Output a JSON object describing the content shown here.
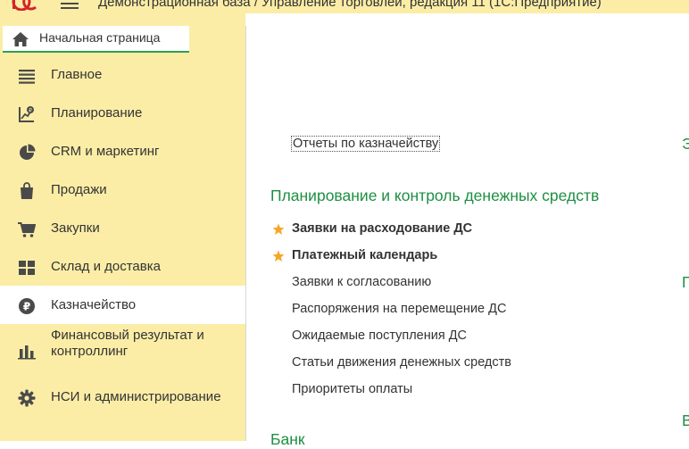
{
  "app": {
    "title": "Демонстрационная база / Управление торговлей, редакция 11  (1С:Предприятие)"
  },
  "home_tab": {
    "label": "Начальная страница",
    "icon": "home-icon"
  },
  "sidebar": {
    "items": [
      {
        "label": "Главное",
        "icon": "list-icon"
      },
      {
        "label": "Планирование",
        "icon": "planning-icon"
      },
      {
        "label": "CRM и маркетинг",
        "icon": "pie-chart-icon"
      },
      {
        "label": "Продажи",
        "icon": "shopping-bag-icon"
      },
      {
        "label": "Закупки",
        "icon": "cart-icon"
      },
      {
        "label": "Склад и доставка",
        "icon": "warehouse-grid-icon"
      },
      {
        "label": "Казначейство",
        "icon": "ruble-icon",
        "active": true
      },
      {
        "label": "Финансовый результат и\nконтроллинг",
        "icon": "bar-chart-icon"
      },
      {
        "label": "НСИ и администрирование",
        "icon": "gear-icon"
      }
    ]
  },
  "content": {
    "reports_link": "Отчеты по казначейству",
    "group_title": "Планирование и контроль денежных средств",
    "links": [
      {
        "label": "Заявки на расходование ДС",
        "favorite": true
      },
      {
        "label": "Платежный календарь",
        "favorite": true
      },
      {
        "label": "Заявки к согласованию",
        "favorite": false
      },
      {
        "label": "Распоряжения на перемещение ДС",
        "favorite": false
      },
      {
        "label": "Ожидаемые поступления ДС",
        "favorite": false
      },
      {
        "label": "Статьи движения денежных средств",
        "favorite": false
      },
      {
        "label": "Приоритеты оплаты",
        "favorite": false
      }
    ],
    "bottom_partial_title": "Банк",
    "right_partial_letters": [
      "Э",
      "П",
      "В"
    ]
  },
  "colors": {
    "panel_bg": "#fbeda6",
    "accent_green": "#1d8f43",
    "star": "#f5a623"
  }
}
